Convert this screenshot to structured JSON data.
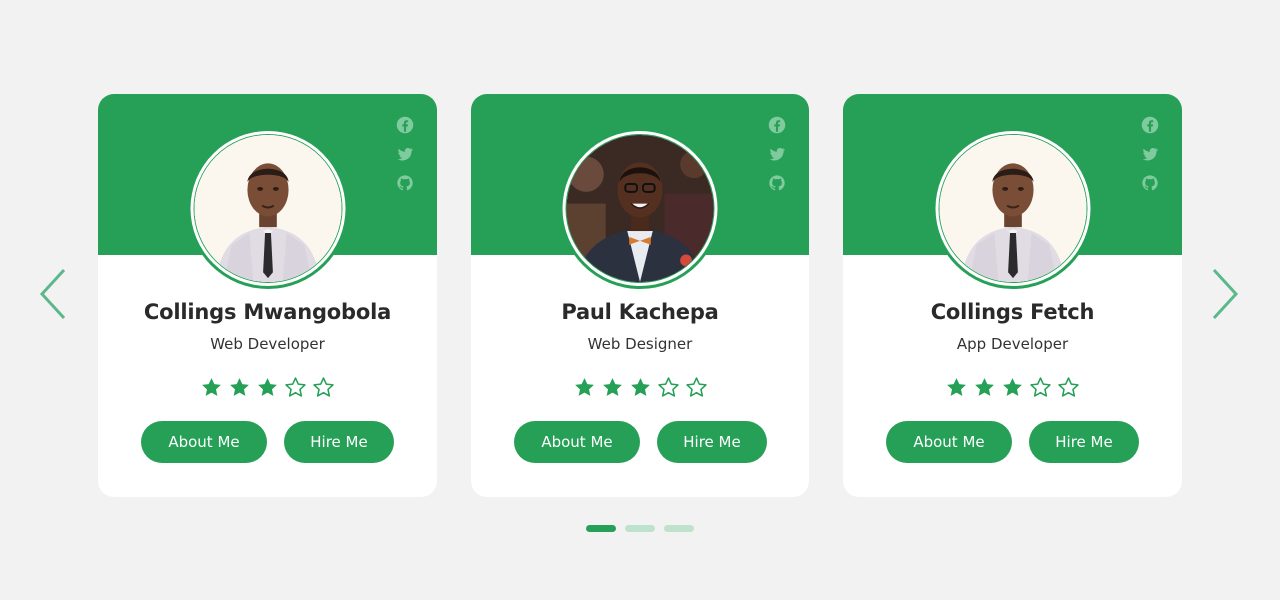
{
  "accent_color": "#26a057",
  "icons": {
    "prev": "chevron-left-icon",
    "next": "chevron-right-icon",
    "social": [
      "facebook-icon",
      "twitter-icon",
      "github-icon"
    ],
    "rating": [
      "star-filled-icon",
      "star-outline-icon"
    ]
  },
  "cards": [
    {
      "name": "Collings Mwangobola",
      "role": "Web Developer",
      "rating": 3,
      "rating_max": 5,
      "about_label": "About Me",
      "hire_label": "Hire Me"
    },
    {
      "name": "Paul Kachepa",
      "role": "Web Designer",
      "rating": 3,
      "rating_max": 5,
      "about_label": "About Me",
      "hire_label": "Hire Me"
    },
    {
      "name": "Collings Fetch",
      "role": "App Developer",
      "rating": 3,
      "rating_max": 5,
      "about_label": "About Me",
      "hire_label": "Hire Me"
    }
  ],
  "pagination": {
    "total": 3,
    "active": 1
  }
}
